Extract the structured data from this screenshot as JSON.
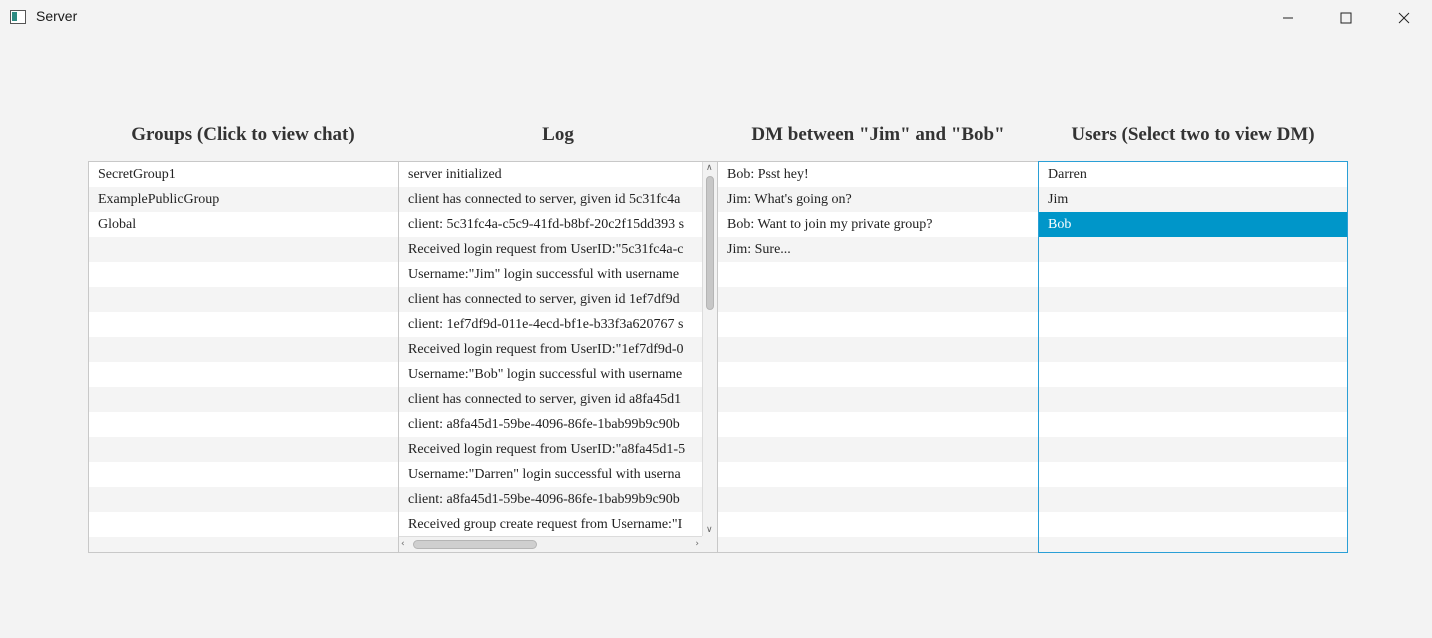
{
  "window": {
    "title": "Server"
  },
  "headers": {
    "groups": "Groups (Click to view chat)",
    "log": "Log",
    "dm": "DM between \"Jim\" and \"Bob\"",
    "users": "Users (Select two to view DM)"
  },
  "groups": [
    "SecretGroup1",
    "ExamplePublicGroup",
    "Global"
  ],
  "log": [
    "server initialized",
    "client has connected to server, given id 5c31fc4a",
    "client: 5c31fc4a-c5c9-41fd-b8bf-20c2f15dd393 s",
    "Received login request from UserID:\"5c31fc4a-c",
    "Username:\"Jim\" login successful with username",
    "client has connected to server, given id 1ef7df9d",
    "client: 1ef7df9d-011e-4ecd-bf1e-b33f3a620767 s",
    "Received login request from UserID:\"1ef7df9d-0",
    "Username:\"Bob\" login successful with username",
    "client has connected to server, given id a8fa45d1",
    "client: a8fa45d1-59be-4096-86fe-1bab99b9c90b",
    "Received login request from UserID:\"a8fa45d1-5",
    "Username:\"Darren\" login successful with userna",
    "client: a8fa45d1-59be-4096-86fe-1bab99b9c90b",
    "Received group create request from Username:\"I"
  ],
  "dm": [
    "Bob: Psst hey!",
    "Jim: What's going on?",
    "Bob: Want to join my private group?",
    "Jim: Sure..."
  ],
  "users": [
    "Darren",
    "Jim",
    "Bob"
  ],
  "selected_user": "Bob",
  "colors": {
    "selection": "#0096c9",
    "focus_border": "#2a9fd6"
  }
}
